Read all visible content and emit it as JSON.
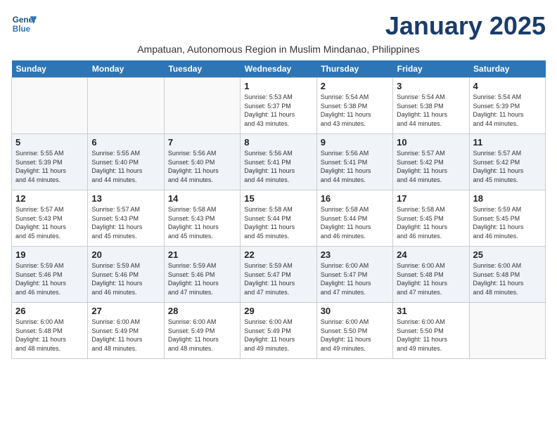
{
  "header": {
    "logo_line1": "General",
    "logo_line2": "Blue",
    "month": "January 2025",
    "subtitle": "Ampatuan, Autonomous Region in Muslim Mindanao, Philippines"
  },
  "weekdays": [
    "Sunday",
    "Monday",
    "Tuesday",
    "Wednesday",
    "Thursday",
    "Friday",
    "Saturday"
  ],
  "weeks": [
    [
      {
        "day": "",
        "info": ""
      },
      {
        "day": "",
        "info": ""
      },
      {
        "day": "",
        "info": ""
      },
      {
        "day": "1",
        "info": "Sunrise: 5:53 AM\nSunset: 5:37 PM\nDaylight: 11 hours\nand 43 minutes."
      },
      {
        "day": "2",
        "info": "Sunrise: 5:54 AM\nSunset: 5:38 PM\nDaylight: 11 hours\nand 43 minutes."
      },
      {
        "day": "3",
        "info": "Sunrise: 5:54 AM\nSunset: 5:38 PM\nDaylight: 11 hours\nand 44 minutes."
      },
      {
        "day": "4",
        "info": "Sunrise: 5:54 AM\nSunset: 5:39 PM\nDaylight: 11 hours\nand 44 minutes."
      }
    ],
    [
      {
        "day": "5",
        "info": "Sunrise: 5:55 AM\nSunset: 5:39 PM\nDaylight: 11 hours\nand 44 minutes."
      },
      {
        "day": "6",
        "info": "Sunrise: 5:55 AM\nSunset: 5:40 PM\nDaylight: 11 hours\nand 44 minutes."
      },
      {
        "day": "7",
        "info": "Sunrise: 5:56 AM\nSunset: 5:40 PM\nDaylight: 11 hours\nand 44 minutes."
      },
      {
        "day": "8",
        "info": "Sunrise: 5:56 AM\nSunset: 5:41 PM\nDaylight: 11 hours\nand 44 minutes."
      },
      {
        "day": "9",
        "info": "Sunrise: 5:56 AM\nSunset: 5:41 PM\nDaylight: 11 hours\nand 44 minutes."
      },
      {
        "day": "10",
        "info": "Sunrise: 5:57 AM\nSunset: 5:42 PM\nDaylight: 11 hours\nand 44 minutes."
      },
      {
        "day": "11",
        "info": "Sunrise: 5:57 AM\nSunset: 5:42 PM\nDaylight: 11 hours\nand 45 minutes."
      }
    ],
    [
      {
        "day": "12",
        "info": "Sunrise: 5:57 AM\nSunset: 5:43 PM\nDaylight: 11 hours\nand 45 minutes."
      },
      {
        "day": "13",
        "info": "Sunrise: 5:57 AM\nSunset: 5:43 PM\nDaylight: 11 hours\nand 45 minutes."
      },
      {
        "day": "14",
        "info": "Sunrise: 5:58 AM\nSunset: 5:43 PM\nDaylight: 11 hours\nand 45 minutes."
      },
      {
        "day": "15",
        "info": "Sunrise: 5:58 AM\nSunset: 5:44 PM\nDaylight: 11 hours\nand 45 minutes."
      },
      {
        "day": "16",
        "info": "Sunrise: 5:58 AM\nSunset: 5:44 PM\nDaylight: 11 hours\nand 46 minutes."
      },
      {
        "day": "17",
        "info": "Sunrise: 5:58 AM\nSunset: 5:45 PM\nDaylight: 11 hours\nand 46 minutes."
      },
      {
        "day": "18",
        "info": "Sunrise: 5:59 AM\nSunset: 5:45 PM\nDaylight: 11 hours\nand 46 minutes."
      }
    ],
    [
      {
        "day": "19",
        "info": "Sunrise: 5:59 AM\nSunset: 5:46 PM\nDaylight: 11 hours\nand 46 minutes."
      },
      {
        "day": "20",
        "info": "Sunrise: 5:59 AM\nSunset: 5:46 PM\nDaylight: 11 hours\nand 46 minutes."
      },
      {
        "day": "21",
        "info": "Sunrise: 5:59 AM\nSunset: 5:46 PM\nDaylight: 11 hours\nand 47 minutes."
      },
      {
        "day": "22",
        "info": "Sunrise: 5:59 AM\nSunset: 5:47 PM\nDaylight: 11 hours\nand 47 minutes."
      },
      {
        "day": "23",
        "info": "Sunrise: 6:00 AM\nSunset: 5:47 PM\nDaylight: 11 hours\nand 47 minutes."
      },
      {
        "day": "24",
        "info": "Sunrise: 6:00 AM\nSunset: 5:48 PM\nDaylight: 11 hours\nand 47 minutes."
      },
      {
        "day": "25",
        "info": "Sunrise: 6:00 AM\nSunset: 5:48 PM\nDaylight: 11 hours\nand 48 minutes."
      }
    ],
    [
      {
        "day": "26",
        "info": "Sunrise: 6:00 AM\nSunset: 5:48 PM\nDaylight: 11 hours\nand 48 minutes."
      },
      {
        "day": "27",
        "info": "Sunrise: 6:00 AM\nSunset: 5:49 PM\nDaylight: 11 hours\nand 48 minutes."
      },
      {
        "day": "28",
        "info": "Sunrise: 6:00 AM\nSunset: 5:49 PM\nDaylight: 11 hours\nand 48 minutes."
      },
      {
        "day": "29",
        "info": "Sunrise: 6:00 AM\nSunset: 5:49 PM\nDaylight: 11 hours\nand 49 minutes."
      },
      {
        "day": "30",
        "info": "Sunrise: 6:00 AM\nSunset: 5:50 PM\nDaylight: 11 hours\nand 49 minutes."
      },
      {
        "day": "31",
        "info": "Sunrise: 6:00 AM\nSunset: 5:50 PM\nDaylight: 11 hours\nand 49 minutes."
      },
      {
        "day": "",
        "info": ""
      }
    ]
  ]
}
